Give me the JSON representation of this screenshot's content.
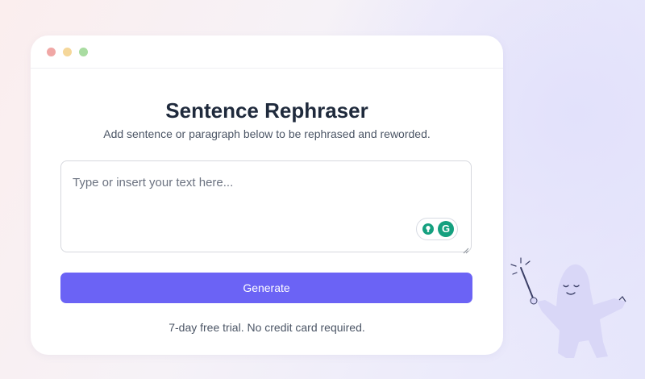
{
  "window": {
    "controls": [
      "close",
      "minimize",
      "maximize"
    ]
  },
  "main": {
    "title": "Sentence Rephraser",
    "subtitle": "Add sentence or paragraph below to be rephrased and reworded.",
    "input_placeholder": "Type or insert your text here...",
    "generate_label": "Generate",
    "trial_note": "7-day free trial. No credit card required."
  },
  "grammarly": {
    "icons": [
      "lightbulb-icon",
      "grammarly-g-icon"
    ],
    "g_letter": "G"
  },
  "colors": {
    "accent": "#6b63f5",
    "grammarly_green": "#15a07f",
    "title_text": "#1f2a3c",
    "mascot": "#d9d7f7"
  }
}
